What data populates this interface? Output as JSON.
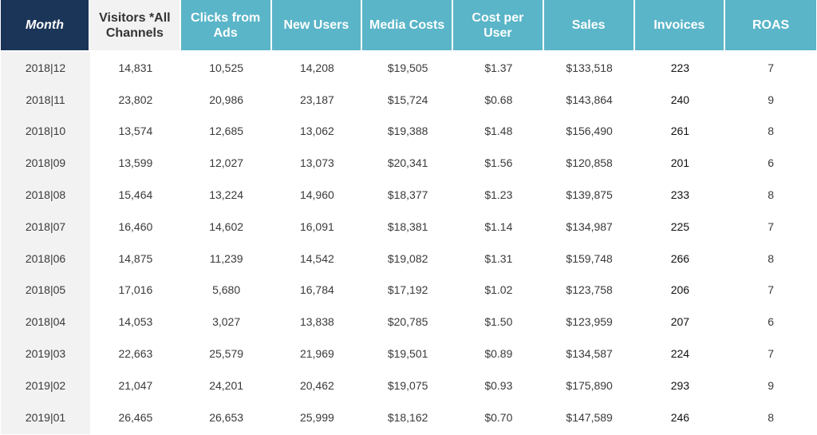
{
  "table": {
    "columns": [
      "Month",
      "Visitors *All Channels",
      "Clicks from Ads",
      "New Users",
      "Media Costs",
      "Cost per User",
      "Sales",
      "Invoices",
      "ROAS"
    ],
    "colors": {
      "month_header_bg": "#1b3558",
      "visitors_header_bg": "#f2f2f2",
      "metric_header_bg": "#5ab5c8",
      "month_column_bg": "#f2f2f2"
    },
    "rows": [
      {
        "month": "2018|12",
        "visitors": "14,831",
        "clicks": "10,525",
        "new_users": "14,208",
        "media_costs": "$19,505",
        "cost_per_user": "$1.37",
        "sales": "$133,518",
        "invoices": "223",
        "roas": "7"
      },
      {
        "month": "2018|11",
        "visitors": "23,802",
        "clicks": "20,986",
        "new_users": "23,187",
        "media_costs": "$15,724",
        "cost_per_user": "$0.68",
        "sales": "$143,864",
        "invoices": "240",
        "roas": "9"
      },
      {
        "month": "2018|10",
        "visitors": "13,574",
        "clicks": "12,685",
        "new_users": "13,062",
        "media_costs": "$19,388",
        "cost_per_user": "$1.48",
        "sales": "$156,490",
        "invoices": "261",
        "roas": "8"
      },
      {
        "month": "2018|09",
        "visitors": "13,599",
        "clicks": "12,027",
        "new_users": "13,073",
        "media_costs": "$20,341",
        "cost_per_user": "$1.56",
        "sales": "$120,858",
        "invoices": "201",
        "roas": "6"
      },
      {
        "month": "2018|08",
        "visitors": "15,464",
        "clicks": "13,224",
        "new_users": "14,960",
        "media_costs": "$18,377",
        "cost_per_user": "$1.23",
        "sales": "$139,875",
        "invoices": "233",
        "roas": "8"
      },
      {
        "month": "2018|07",
        "visitors": "16,460",
        "clicks": "14,602",
        "new_users": "16,091",
        "media_costs": "$18,381",
        "cost_per_user": "$1.14",
        "sales": "$134,987",
        "invoices": "225",
        "roas": "7"
      },
      {
        "month": "2018|06",
        "visitors": "14,875",
        "clicks": "11,239",
        "new_users": "14,542",
        "media_costs": "$19,082",
        "cost_per_user": "$1.31",
        "sales": "$159,748",
        "invoices": "266",
        "roas": "8"
      },
      {
        "month": "2018|05",
        "visitors": "17,016",
        "clicks": "5,680",
        "new_users": "16,784",
        "media_costs": "$17,192",
        "cost_per_user": "$1.02",
        "sales": "$123,758",
        "invoices": "206",
        "roas": "7"
      },
      {
        "month": "2018|04",
        "visitors": "14,053",
        "clicks": "3,027",
        "new_users": "13,838",
        "media_costs": "$20,785",
        "cost_per_user": "$1.50",
        "sales": "$123,959",
        "invoices": "207",
        "roas": "6"
      },
      {
        "month": "2019|03",
        "visitors": "22,663",
        "clicks": "25,579",
        "new_users": "21,969",
        "media_costs": "$19,501",
        "cost_per_user": "$0.89",
        "sales": "$134,587",
        "invoices": "224",
        "roas": "7"
      },
      {
        "month": "2019|02",
        "visitors": "21,047",
        "clicks": "24,201",
        "new_users": "20,462",
        "media_costs": "$19,075",
        "cost_per_user": "$0.93",
        "sales": "$175,890",
        "invoices": "293",
        "roas": "9"
      },
      {
        "month": "2019|01",
        "visitors": "26,465",
        "clicks": "26,653",
        "new_users": "25,999",
        "media_costs": "$18,162",
        "cost_per_user": "$0.70",
        "sales": "$147,589",
        "invoices": "246",
        "roas": "8"
      }
    ]
  }
}
